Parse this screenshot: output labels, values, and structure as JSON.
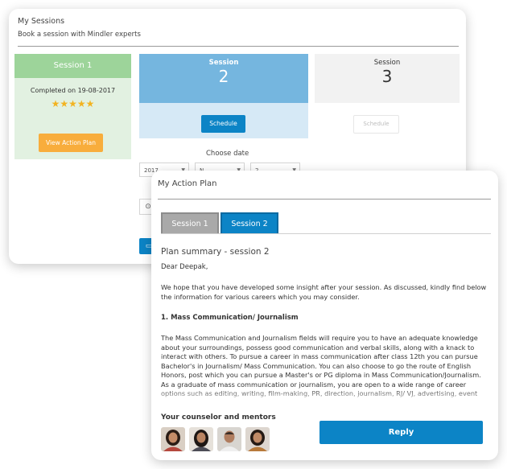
{
  "sessions": {
    "title": "My Sessions",
    "subtitle": "Book a session with Mindler experts",
    "session1": {
      "label": "Session 1",
      "completed": "Completed on 19-08-2017",
      "stars": "★★★★★",
      "rating": 5,
      "button": "View Action Plan"
    },
    "session2": {
      "label": "Session",
      "number": "2",
      "button": "Schedule"
    },
    "session3": {
      "label": "Session",
      "number": "3",
      "button": "Schedule"
    },
    "choose_date": "Choose date",
    "date_selects": [
      "2017",
      "N",
      "2"
    ],
    "colors": {
      "green_head": "#9dd49a",
      "blue_head": "#75b6df",
      "primary": "#0c84c6",
      "orange": "#f8ad3c",
      "star": "#f2b321"
    }
  },
  "plan": {
    "title": "My Action Plan",
    "tabs": [
      "Session 1",
      "Session 2"
    ],
    "active_tab": "Session 2",
    "heading": "Plan summary - session 2",
    "greeting": "Dear Deepak,",
    "intro": "We hope that you have developed some insight after your session. As discussed, kindly find below the information for various careers which you may consider.",
    "section_title": "1. Mass Communication/ Journalism",
    "section_body": "The Mass Communication and Journalism fields will require you to have an adequate knowledge about your surroundings, possess good communication and verbal skills, along with a knack to interact with others. To pursue a career in mass communication after class 12th you can pursue Bachelor's in Journalism/ Mass Communication. You can also choose to go the route of English Honors, post which you can pursue a Master's or PG diploma in Mass Communication/Journalism. As a graduate of mass communication or journalism, you are open to a wide range of career options such as editing, writing, film-making, PR, direction, journalism, RJ/ VJ, advertising, event",
    "mentors_title": "Your counselor and mentors",
    "mentor_icons": [
      "mentor-avatar-1",
      "mentor-avatar-2",
      "mentor-avatar-3",
      "mentor-avatar-4"
    ],
    "reply_label": "Reply"
  }
}
